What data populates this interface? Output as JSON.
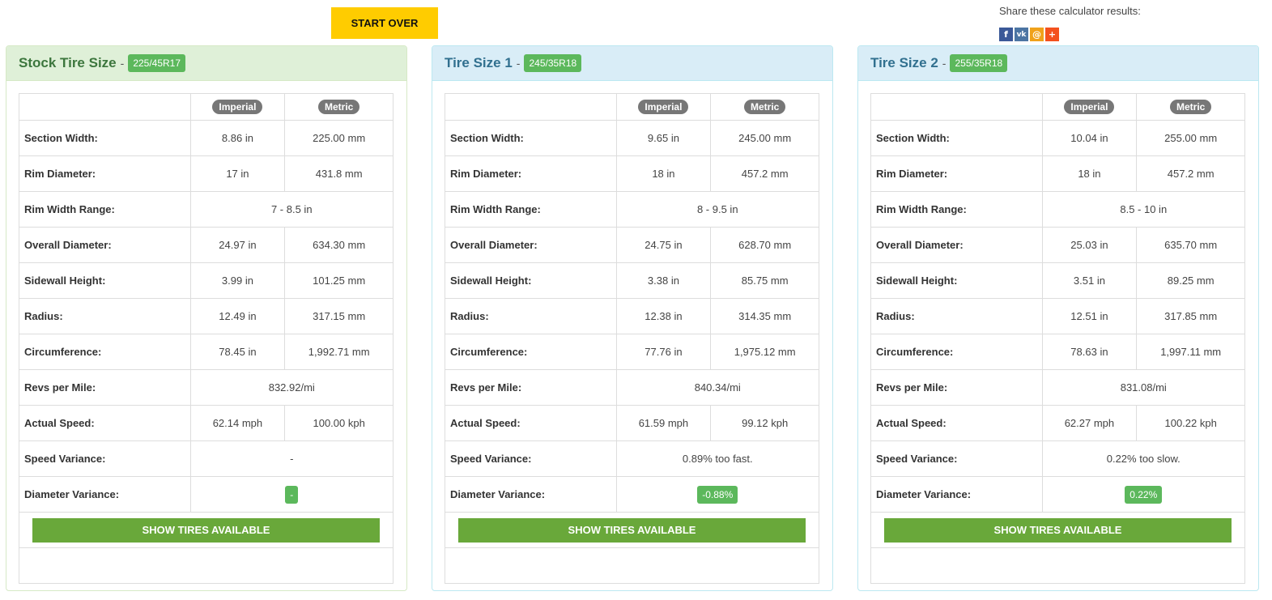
{
  "start_over_label": "START OVER",
  "share": {
    "label": "Share these calculator results:",
    "icons": [
      {
        "name": "facebook-icon",
        "glyph": "f"
      },
      {
        "name": "vk-icon",
        "glyph": "vk"
      },
      {
        "name": "email-icon",
        "glyph": "@"
      },
      {
        "name": "plus-icon",
        "glyph": "+"
      }
    ]
  },
  "headers": {
    "imperial": "Imperial",
    "metric": "Metric"
  },
  "row_labels": {
    "section_width": "Section Width:",
    "rim_diameter": "Rim Diameter:",
    "rim_width_range": "Rim Width Range:",
    "overall_diameter": "Overall Diameter:",
    "sidewall_height": "Sidewall Height:",
    "radius": "Radius:",
    "circumference": "Circumference:",
    "revs_per_mile": "Revs per Mile:",
    "actual_speed": "Actual Speed:",
    "speed_variance": "Speed Variance:",
    "diameter_variance": "Diameter Variance:"
  },
  "show_tires_label": "SHOW TIRES AVAILABLE",
  "panels": [
    {
      "title": "Stock Tire Size",
      "size": "225/45R17",
      "section_width": {
        "imperial": "8.86 in",
        "metric": "225.00 mm"
      },
      "rim_diameter": {
        "imperial": "17 in",
        "metric": "431.8 mm"
      },
      "rim_width_range": "7 - 8.5 in",
      "overall_diameter": {
        "imperial": "24.97 in",
        "metric": "634.30 mm"
      },
      "sidewall_height": {
        "imperial": "3.99 in",
        "metric": "101.25 mm"
      },
      "radius": {
        "imperial": "12.49 in",
        "metric": "317.15 mm"
      },
      "circumference": {
        "imperial": "78.45 in",
        "metric": "1,992.71 mm"
      },
      "revs_per_mile": "832.92/mi",
      "actual_speed": {
        "imperial": "62.14 mph",
        "metric": "100.00 kph"
      },
      "speed_variance": "-",
      "diameter_variance": "-"
    },
    {
      "title": "Tire Size 1",
      "size": "245/35R18",
      "section_width": {
        "imperial": "9.65 in",
        "metric": "245.00 mm"
      },
      "rim_diameter": {
        "imperial": "18 in",
        "metric": "457.2 mm"
      },
      "rim_width_range": "8 - 9.5 in",
      "overall_diameter": {
        "imperial": "24.75 in",
        "metric": "628.70 mm"
      },
      "sidewall_height": {
        "imperial": "3.38 in",
        "metric": "85.75 mm"
      },
      "radius": {
        "imperial": "12.38 in",
        "metric": "314.35 mm"
      },
      "circumference": {
        "imperial": "77.76 in",
        "metric": "1,975.12 mm"
      },
      "revs_per_mile": "840.34/mi",
      "actual_speed": {
        "imperial": "61.59 mph",
        "metric": "99.12 kph"
      },
      "speed_variance": "0.89% too fast.",
      "diameter_variance": "-0.88%"
    },
    {
      "title": "Tire Size 2",
      "size": "255/35R18",
      "section_width": {
        "imperial": "10.04 in",
        "metric": "255.00 mm"
      },
      "rim_diameter": {
        "imperial": "18 in",
        "metric": "457.2 mm"
      },
      "rim_width_range": "8.5 - 10 in",
      "overall_diameter": {
        "imperial": "25.03 in",
        "metric": "635.70 mm"
      },
      "sidewall_height": {
        "imperial": "3.51 in",
        "metric": "89.25 mm"
      },
      "radius": {
        "imperial": "12.51 in",
        "metric": "317.85 mm"
      },
      "circumference": {
        "imperial": "78.63 in",
        "metric": "1,997.11 mm"
      },
      "revs_per_mile": "831.08/mi",
      "actual_speed": {
        "imperial": "62.27 mph",
        "metric": "100.22 kph"
      },
      "speed_variance": "0.22% too slow.",
      "diameter_variance": "0.22%"
    }
  ]
}
